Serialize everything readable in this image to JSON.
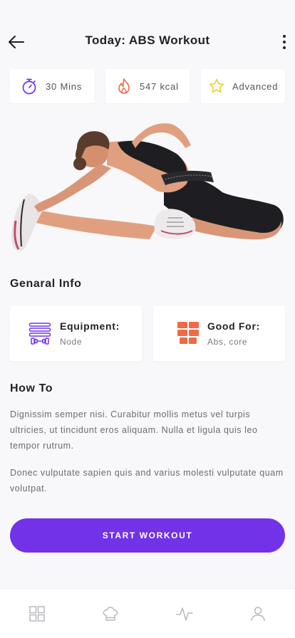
{
  "header": {
    "title": "Today: ABS Workout"
  },
  "stats": [
    {
      "icon": "stopwatch-icon",
      "value": "30 Mins"
    },
    {
      "icon": "flame-icon",
      "value": "547 kcal"
    },
    {
      "icon": "star-icon",
      "value": "Advanced"
    }
  ],
  "general_info": {
    "title": "Genaral Info",
    "equipment": {
      "label": "Equipment:",
      "value": "Node",
      "icon": "equipment-icon"
    },
    "good_for": {
      "label": "Good For:",
      "value": "Abs, core",
      "icon": "muscle-grid-icon"
    }
  },
  "how_to": {
    "title": "How To",
    "paragraphs": [
      "Dignissim semper nisi. Curabitur mollis metus vel turpis ultricies, ut tincidunt eros aliquam. Nulla et ligula quis leo tempor rutrum.",
      "Donec vulputate sapien quis and varius molesti vulputate quam volutpat."
    ]
  },
  "cta": {
    "label": "START WORKOUT"
  },
  "tabbar": [
    {
      "icon": "grid-icon"
    },
    {
      "icon": "chef-hat-icon"
    },
    {
      "icon": "activity-icon"
    },
    {
      "icon": "profile-icon"
    }
  ],
  "colors": {
    "accent": "#7132e8",
    "orange": "#ef6a45",
    "star": "#f3cf2a",
    "background": "#f8f8fa"
  }
}
